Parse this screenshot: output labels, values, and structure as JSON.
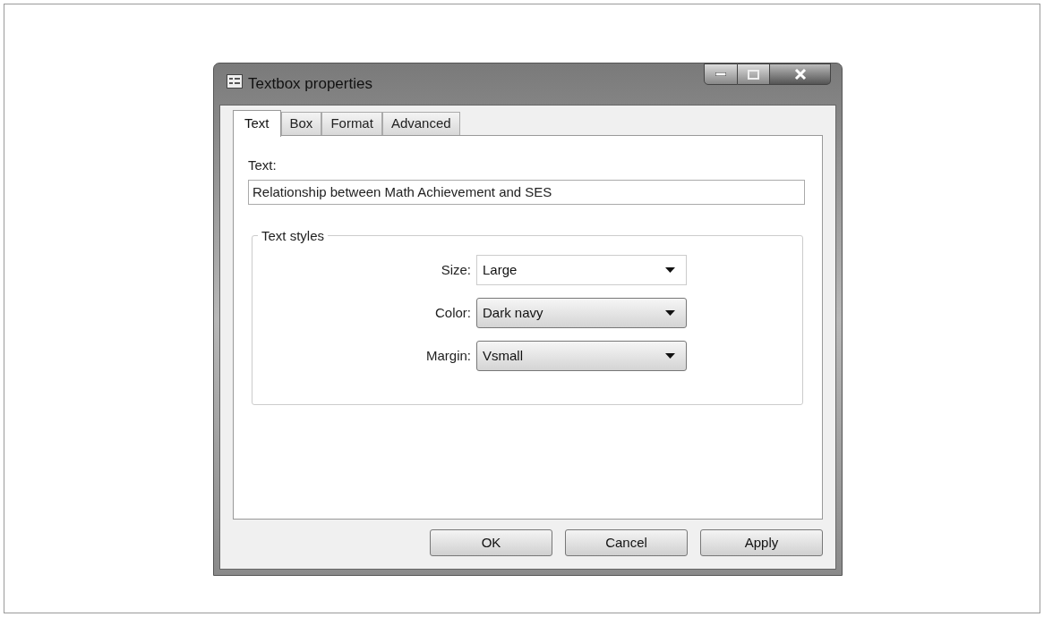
{
  "window": {
    "title": "Textbox properties"
  },
  "tabs": [
    {
      "label": "Text",
      "selected": true
    },
    {
      "label": "Box",
      "selected": false
    },
    {
      "label": "Format",
      "selected": false
    },
    {
      "label": "Advanced",
      "selected": false
    }
  ],
  "text_field": {
    "label": "Text:",
    "value": "Relationship between Math Achievement and SES"
  },
  "group": {
    "legend": "Text styles",
    "rows": [
      {
        "label": "Size:",
        "value": "Large",
        "kind": "editable"
      },
      {
        "label": "Color:",
        "value": "Dark navy",
        "kind": "list"
      },
      {
        "label": "Margin:",
        "value": "Vsmall",
        "kind": "list"
      }
    ]
  },
  "buttons": [
    "OK",
    "Cancel",
    "Apply"
  ]
}
